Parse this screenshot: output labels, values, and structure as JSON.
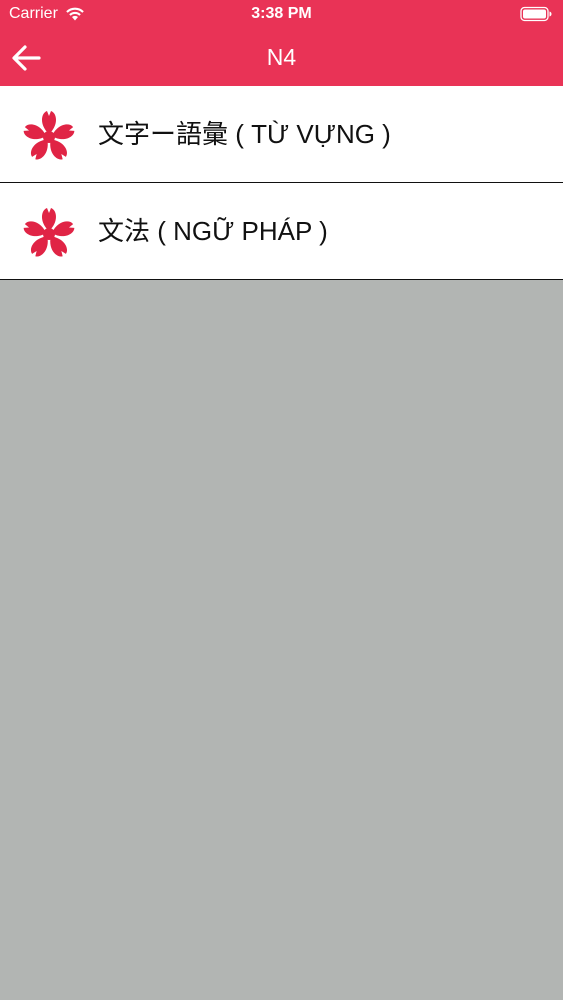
{
  "status_bar": {
    "carrier": "Carrier",
    "time": "3:38 PM",
    "wifi_icon": "wifi-icon",
    "battery_icon": "battery-icon"
  },
  "nav": {
    "title": "N4",
    "back_icon": "arrow-left-icon"
  },
  "list": {
    "items": [
      {
        "label": "文字ー語彙 ( TỪ VỰNG )",
        "icon": "sakura-flower-icon"
      },
      {
        "label": "文法 ( NGỮ PHÁP )",
        "icon": "sakura-flower-icon"
      }
    ]
  },
  "colors": {
    "header": "#e93356",
    "flower": "#e02445",
    "background": "#b2b5b3"
  }
}
